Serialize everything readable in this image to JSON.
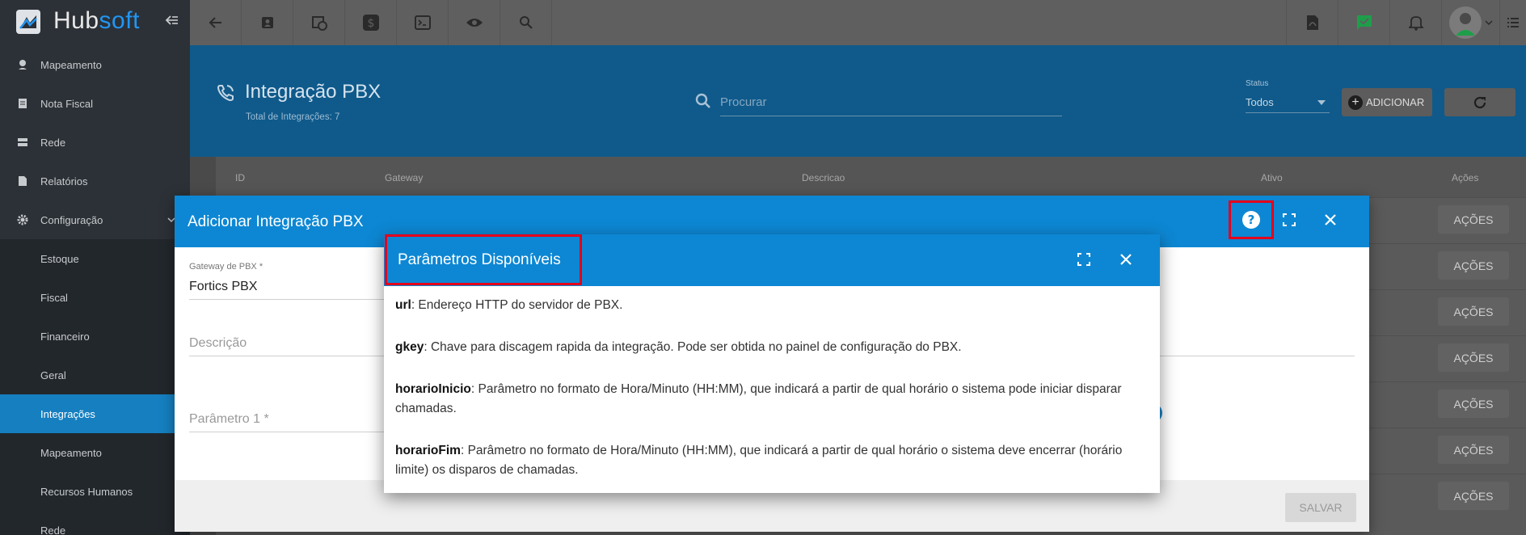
{
  "brand": {
    "name_part1": "Hub",
    "name_part2": "soft"
  },
  "sidebar": {
    "items": [
      {
        "label": "Mapeamento",
        "icon": "map-pin-icon"
      },
      {
        "label": "Nota Fiscal",
        "icon": "document-icon"
      },
      {
        "label": "Rede",
        "icon": "server-icon"
      },
      {
        "label": "Relatórios",
        "icon": "report-icon"
      },
      {
        "label": "Configuração",
        "icon": "gear-icon"
      }
    ],
    "subitems": [
      "Estoque",
      "Fiscal",
      "Financeiro",
      "Geral",
      "Integrações",
      "Mapeamento",
      "Recursos Humanos",
      "Rede"
    ],
    "active": "Integrações"
  },
  "page": {
    "title": "Integração PBX",
    "subtitle": "Total de Integrações: 7",
    "search_placeholder": "Procurar",
    "status_label": "Status",
    "status_value": "Todos",
    "add_label": "ADICIONAR"
  },
  "table": {
    "columns": [
      "ID",
      "Gateway",
      "Descricao",
      "Ativo",
      "Ações"
    ],
    "row_action_label": "AÇÕES",
    "row_count": 7
  },
  "modal": {
    "title": "Adicionar Integração PBX",
    "gateway_label": "Gateway de PBX *",
    "gateway_value": "Fortics PBX",
    "descricao_placeholder": "Descrição",
    "parametro_placeholder": "Parâmetro 1 *",
    "save_label": "SALVAR"
  },
  "popup": {
    "title": "Parâmetros Disponíveis",
    "params": [
      {
        "name": "url",
        "desc": ": Endereço HTTP do servidor de PBX."
      },
      {
        "name": "gkey",
        "desc": ": Chave para discagem rapida da integração. Pode ser obtida no painel de configuração do PBX."
      },
      {
        "name": "horarioInicio",
        "desc": ": Parâmetro no formato de Hora/Minuto (HH:MM), que indicará a partir de qual horário o sistema pode iniciar disparar chamadas."
      },
      {
        "name": "horarioFim",
        "desc": ": Parâmetro no formato de Hora/Minuto (HH:MM), que indicará a partir de qual horário o sistema deve encerrar (horário limite) os disparos de chamadas."
      }
    ]
  },
  "colors": {
    "accent": "#0d87d3",
    "highlight": "#e4001c",
    "sidebar": "#2c3137",
    "active": "#157fc0"
  }
}
